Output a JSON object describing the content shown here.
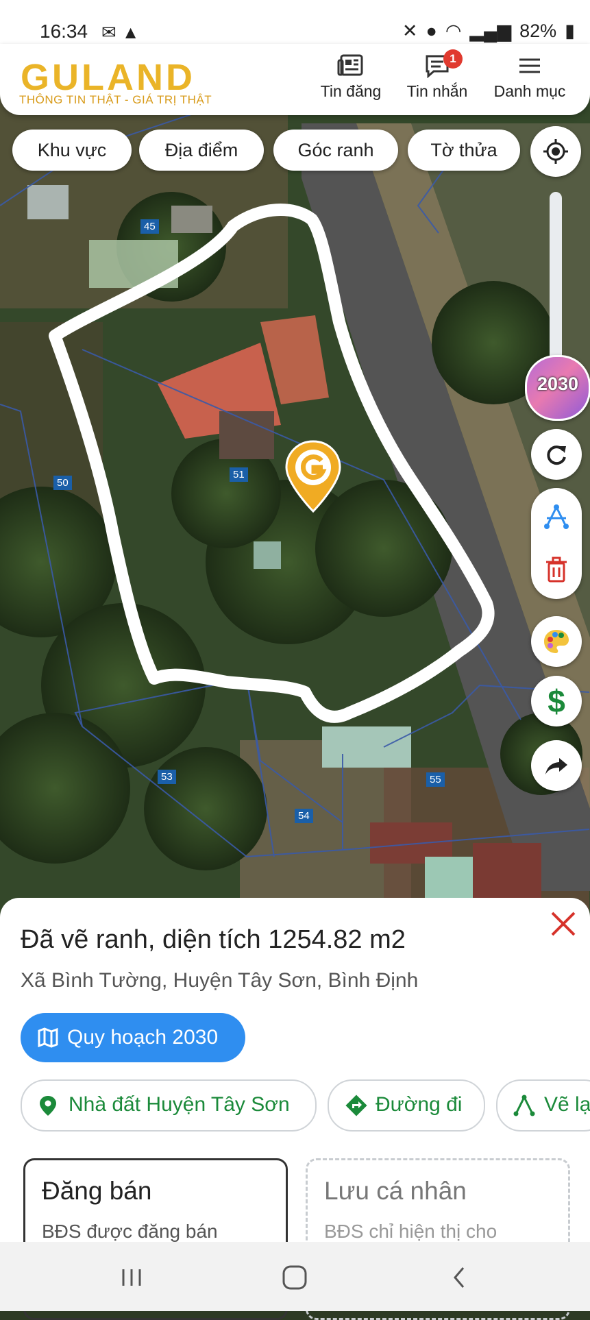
{
  "status_bar": {
    "time": "16:34",
    "battery": "82%",
    "left_icons": [
      "messenger-icon",
      "warning-icon"
    ],
    "right_icons": [
      "mute-icon",
      "location-icon",
      "wifi-icon",
      "signal-icon",
      "signal-icon",
      "battery-icon"
    ]
  },
  "header": {
    "logo": "GULAND",
    "tagline": "THÔNG TIN THẬT - GIÁ TRỊ THẬT",
    "nav": [
      {
        "label": "Tin đăng",
        "icon": "newspaper-icon"
      },
      {
        "label": "Tin nhắn",
        "icon": "message-icon",
        "badge": "1"
      },
      {
        "label": "Danh mục",
        "icon": "menu-icon"
      }
    ]
  },
  "filters": [
    "Khu vực",
    "Địa điểm",
    "Góc ranh",
    "Tờ thửa"
  ],
  "map": {
    "parcels": [
      "45",
      "50",
      "51",
      "53",
      "54",
      "55"
    ],
    "plan_year_button": "2030",
    "side_tools": [
      "locate-icon",
      "refresh-icon",
      "draw-icon",
      "trash-icon",
      "palette-icon",
      "price-icon",
      "share-icon"
    ]
  },
  "sheet": {
    "title": "Đã vẽ ranh, diện tích 1254.82 m2",
    "address": "Xã Bình Tường, Huyện Tây Sơn, Bình Định",
    "planning_button": "Quy hoạch 2030",
    "actions": [
      "Nhà đất Huyện Tây Sơn",
      "Đường đi",
      "Vẽ lại"
    ],
    "cards": [
      {
        "title": "Đăng bán",
        "subtitle": "BĐS được đăng bán"
      },
      {
        "title": "Lưu cá nhân",
        "subtitle": "BĐS chỉ hiện thị cho"
      }
    ]
  },
  "colors": {
    "brand_gold": "#eab428",
    "accent_blue": "#2f8ef0",
    "action_green": "#1b8a3a",
    "close_red": "#d6322a"
  }
}
